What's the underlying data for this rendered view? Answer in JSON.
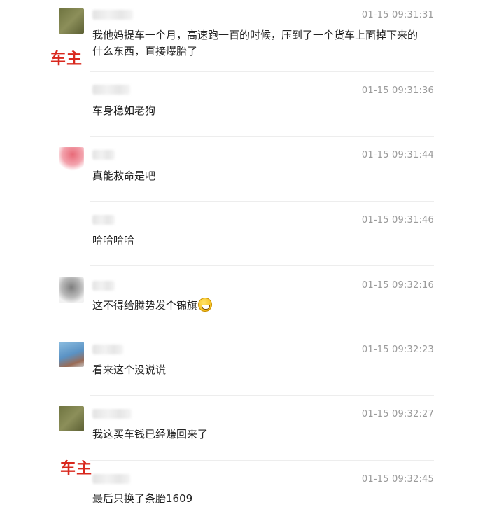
{
  "comments": [
    {
      "time": "01-15 09:31:31",
      "text": "我他妈提车一个月，高速跑一百的时候，压到了一个货车上面掉下来的什么东西，直接爆胎了",
      "avatar": "avatar-olive"
    },
    {
      "time": "01-15 09:31:36",
      "text": "车身稳如老狗",
      "avatar": "none"
    },
    {
      "time": "01-15 09:31:44",
      "text": "真能救命是吧",
      "avatar": "avatar-pink"
    },
    {
      "time": "01-15 09:31:46",
      "text": "哈哈哈哈",
      "avatar": "none"
    },
    {
      "time": "01-15 09:32:16",
      "text": "这不得给腾势发个锦旗",
      "avatar": "avatar-gray"
    },
    {
      "time": "01-15 09:32:23",
      "text": "看来这个没说谎",
      "avatar": "avatar-blue"
    },
    {
      "time": "01-15 09:32:27",
      "text": "我这买车钱已经赚回来了",
      "avatar": "avatar-olive"
    },
    {
      "time": "01-15 09:32:45",
      "text": "最后只换了条胎1609",
      "avatar": "none"
    }
  ],
  "owner_labels": [
    "车主",
    "车主"
  ],
  "emoji": {
    "icon": "grin-emoji-icon"
  },
  "colors": {
    "owner_label": "#d9281e",
    "time": "#9a9a9a",
    "text": "#222222"
  }
}
